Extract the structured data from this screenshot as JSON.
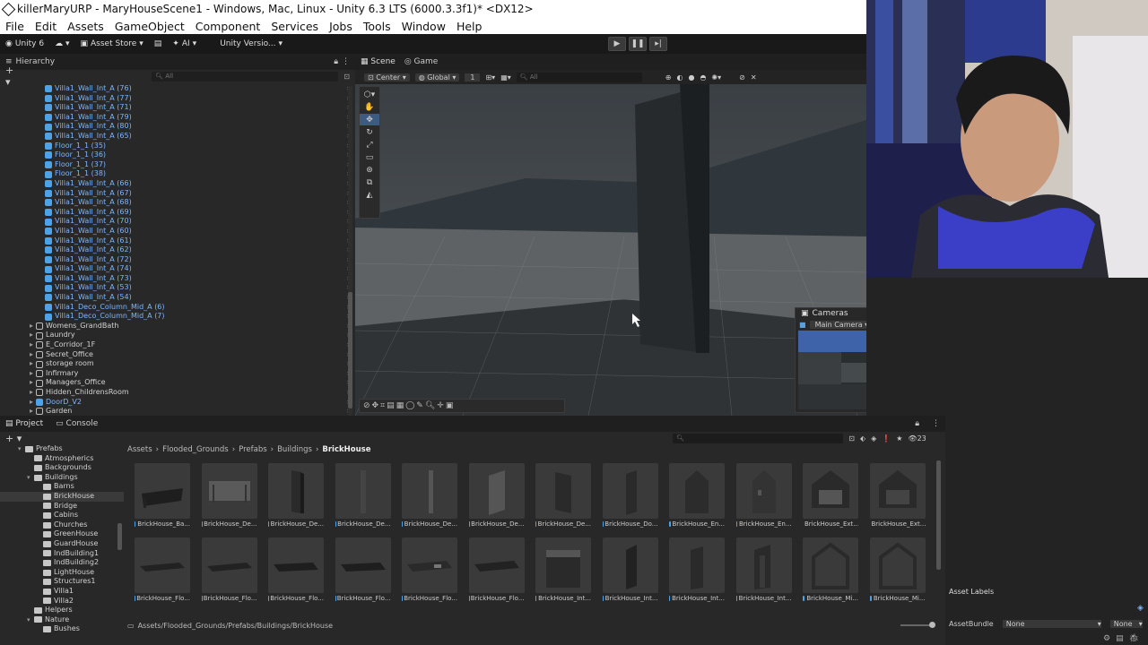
{
  "window": {
    "title": "killerMaryURP - MaryHouseScene1 - Windows, Mac, Linux - Unity 6.3 LTS (6000.3.3f1)* <DX12>"
  },
  "menu": [
    "File",
    "Edit",
    "Assets",
    "GameObject",
    "Component",
    "Services",
    "Jobs",
    "Tools",
    "Window",
    "Help"
  ],
  "toolbar": {
    "account": "Unity 6",
    "asset_store": "Asset Store",
    "ai": "AI",
    "version": "Unity Versio..."
  },
  "hierarchy": {
    "tab": "Hierarchy",
    "search_placeholder": "All",
    "items": [
      {
        "label": "Villa1_Wall_Int_A (76)",
        "prefab": true
      },
      {
        "label": "Villa1_Wall_Int_A (77)",
        "prefab": true
      },
      {
        "label": "Villa1_Wall_Int_A (71)",
        "prefab": true
      },
      {
        "label": "Villa1_Wall_Int_A (79)",
        "prefab": true
      },
      {
        "label": "Villa1_Wall_Int_A (80)",
        "prefab": true
      },
      {
        "label": "Villa1_Wall_Int_A (65)",
        "prefab": true
      },
      {
        "label": "Floor_1_1 (35)",
        "prefab": true
      },
      {
        "label": "Floor_1_1 (36)",
        "prefab": true
      },
      {
        "label": "Floor_1_1 (37)",
        "prefab": true
      },
      {
        "label": "Floor_1_1 (38)",
        "prefab": true
      },
      {
        "label": "Villa1_Wall_Int_A (66)",
        "prefab": true
      },
      {
        "label": "Villa1_Wall_Int_A (67)",
        "prefab": true
      },
      {
        "label": "Villa1_Wall_Int_A (68)",
        "prefab": true
      },
      {
        "label": "Villa1_Wall_Int_A (69)",
        "prefab": true
      },
      {
        "label": "Villa1_Wall_Int_A (70)",
        "prefab": true
      },
      {
        "label": "Villa1_Wall_Int_A (60)",
        "prefab": true
      },
      {
        "label": "Villa1_Wall_Int_A (61)",
        "prefab": true
      },
      {
        "label": "Villa1_Wall_Int_A (62)",
        "prefab": true
      },
      {
        "label": "Villa1_Wall_Int_A (72)",
        "prefab": true
      },
      {
        "label": "Villa1_Wall_Int_A (74)",
        "prefab": true
      },
      {
        "label": "Villa1_Wall_Int_A (73)",
        "prefab": true
      },
      {
        "label": "Villa1_Wall_Int_A (53)",
        "prefab": true
      },
      {
        "label": "Villa1_Wall_Int_A (54)",
        "prefab": true
      },
      {
        "label": "Villa1_Deco_Column_Mid_A (6)",
        "prefab": true
      },
      {
        "label": "Villa1_Deco_Column_Mid_A (7)",
        "prefab": true
      },
      {
        "label": "Womens_GrandBath",
        "prefab": false
      },
      {
        "label": "Laundry",
        "prefab": false
      },
      {
        "label": "E_Corridor_1F",
        "prefab": false
      },
      {
        "label": "Secret_Office",
        "prefab": false
      },
      {
        "label": "storage room",
        "prefab": false
      },
      {
        "label": "Infirmary",
        "prefab": false
      },
      {
        "label": "Managers_Office",
        "prefab": false
      },
      {
        "label": "Hidden_ChildrensRoom",
        "prefab": false
      },
      {
        "label": "DoorD_V2",
        "prefab": true
      },
      {
        "label": "Garden",
        "prefab": false
      }
    ]
  },
  "scene": {
    "tabs": [
      "Scene",
      "Game"
    ],
    "pivot": "Center",
    "space": "Global",
    "snap_value": "1",
    "search_placeholder": "All"
  },
  "cameras_overlay": {
    "title": "Cameras",
    "selected": "Main Camera"
  },
  "project": {
    "tabs": [
      "Project",
      "Console"
    ],
    "count": "23",
    "breadcrumb": [
      "Assets",
      "Flooded_Grounds",
      "Prefabs",
      "Buildings",
      "BrickHouse"
    ],
    "path": "Assets/Flooded_Grounds/Prefabs/Buildings/BrickHouse",
    "folders": [
      {
        "label": "Prefabs",
        "indent": 0,
        "expanded": true
      },
      {
        "label": "Atmospherics",
        "indent": 1
      },
      {
        "label": "Backgrounds",
        "indent": 1
      },
      {
        "label": "Buildings",
        "indent": 1,
        "expanded": true
      },
      {
        "label": "Barns",
        "indent": 2
      },
      {
        "label": "BrickHouse",
        "indent": 2,
        "selected": true
      },
      {
        "label": "Bridge",
        "indent": 2
      },
      {
        "label": "Cabins",
        "indent": 2
      },
      {
        "label": "Churches",
        "indent": 2
      },
      {
        "label": "GreenHouse",
        "indent": 2
      },
      {
        "label": "GuardHouse",
        "indent": 2
      },
      {
        "label": "IndBuilding1",
        "indent": 2
      },
      {
        "label": "IndBuilding2",
        "indent": 2
      },
      {
        "label": "LightHouse",
        "indent": 2
      },
      {
        "label": "Structures1",
        "indent": 2
      },
      {
        "label": "Villa1",
        "indent": 2
      },
      {
        "label": "Villa2",
        "indent": 2
      },
      {
        "label": "Helpers",
        "indent": 1
      },
      {
        "label": "Nature",
        "indent": 1,
        "expanded": true
      },
      {
        "label": "Bushes",
        "indent": 2
      }
    ],
    "assets_row1": [
      "BrickHouse_Ba...",
      "BrickHouse_De...",
      "BrickHouse_De...",
      "BrickHouse_De...",
      "BrickHouse_De...",
      "BrickHouse_De...",
      "BrickHouse_De...",
      "BrickHouse_Do...",
      "BrickHouse_En...",
      "BrickHouse_En...",
      "BrickHouse_Ext...",
      "BrickHouse_Ext..."
    ],
    "assets_row2": [
      "BrickHouse_Flo...",
      "BrickHouse_Flo...",
      "BrickHouse_Flo...",
      "BrickHouse_Flo...",
      "BrickHouse_Flo...",
      "BrickHouse_Flo...",
      "BrickHouse_Int...",
      "BrickHouse_Int...",
      "BrickHouse_Int...",
      "BrickHouse_Int...",
      "BrickHouse_Mi...",
      "BrickHouse_Mi..."
    ]
  },
  "inspector": {
    "asset_labels": "Asset Labels",
    "asset_bundle_label": "AssetBundle",
    "bundle_value": "None",
    "variant_value": "None"
  }
}
